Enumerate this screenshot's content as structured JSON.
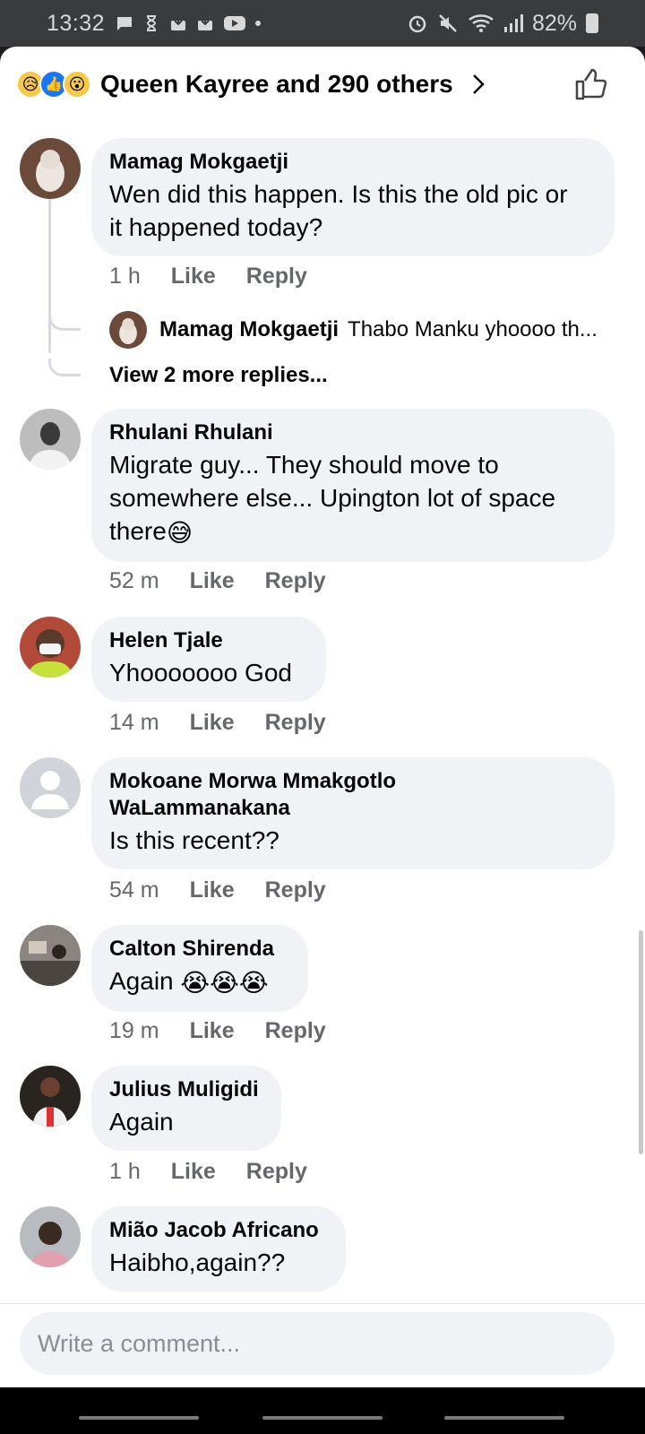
{
  "status_bar": {
    "time": "13:32",
    "battery": "82%",
    "icons_left": [
      "message-icon",
      "hourglass-icon",
      "download-icon",
      "download-icon",
      "youtube-icon",
      "dot"
    ],
    "icons_right": [
      "alarm-icon",
      "mute-icon",
      "wifi-icon",
      "signal-icon",
      "battery-icon"
    ]
  },
  "header": {
    "reactions": [
      "sad-reaction",
      "like-reaction",
      "wow-reaction"
    ],
    "summary": "Queen Kayree and 290 others"
  },
  "comments": [
    {
      "author": "Mamag Mokgaetji",
      "text_lines": [
        "Wen did this happen. Is this the old pic or",
        "it happened today?"
      ],
      "time": "1 h",
      "like": "Like",
      "reply": "Reply",
      "reply_preview": {
        "author": "Mamag Mokgaetji",
        "snippet": "Thabo Manku yhoooo th..."
      },
      "view_more": "View 2 more replies..."
    },
    {
      "author": "Rhulani Rhulani",
      "text_lines": [
        "Migrate guy... They should move to",
        "somewhere else... Upington lot of space",
        "there"
      ],
      "emoji": "😅",
      "time": "52 m",
      "like": "Like",
      "reply": "Reply"
    },
    {
      "author": "Helen Tjale",
      "text_lines": [
        "Yhooooooo God"
      ],
      "time": "14 m",
      "like": "Like",
      "reply": "Reply"
    },
    {
      "author_lines": [
        "Mokoane Morwa Mmakgotlo",
        "WaLammanakana"
      ],
      "text_lines": [
        "Is this recent??"
      ],
      "time": "54 m",
      "like": "Like",
      "reply": "Reply"
    },
    {
      "author": "Calton Shirenda",
      "text_lines": [
        "Again"
      ],
      "emoji": "😭😭😭",
      "time": "19 m",
      "like": "Like",
      "reply": "Reply"
    },
    {
      "author": "Julius Muligidi",
      "text_lines": [
        "Again"
      ],
      "time": "1 h",
      "like": "Like",
      "reply": "Reply"
    },
    {
      "author": "Mião Jacob Africano",
      "text_lines": [
        "Haibho,again??"
      ]
    }
  ],
  "composer": {
    "placeholder": "Write a comment..."
  },
  "colors": {
    "bubble": "#f0f2f5",
    "meta_text": "#65676b",
    "like_blue": "#1877f2",
    "status_bar": "#3a3b3c"
  }
}
